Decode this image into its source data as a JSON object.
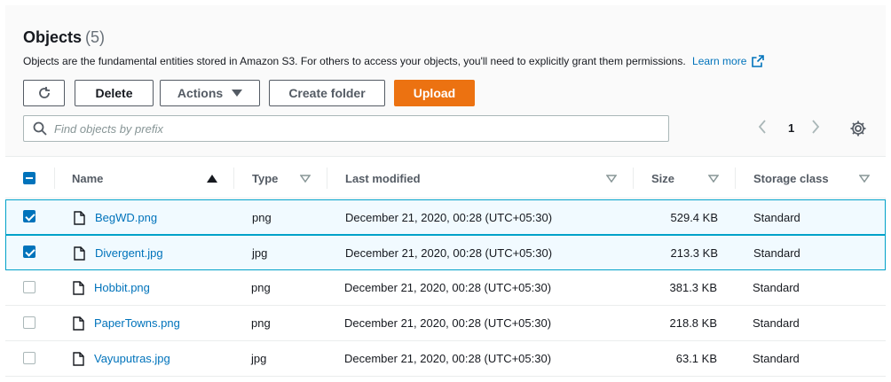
{
  "header": {
    "title": "Objects",
    "count": "(5)",
    "description": "Objects are the fundamental entities stored in Amazon S3. For others to access your objects, you'll need to explicitly grant them permissions.",
    "learn_more": "Learn more"
  },
  "toolbar": {
    "delete_label": "Delete",
    "actions_label": "Actions",
    "create_folder_label": "Create folder",
    "upload_label": "Upload"
  },
  "search": {
    "placeholder": "Find objects by prefix"
  },
  "pagination": {
    "current_page": "1"
  },
  "table": {
    "columns": {
      "name": "Name",
      "type": "Type",
      "last_modified": "Last modified",
      "size": "Size",
      "storage_class": "Storage class"
    },
    "rows": [
      {
        "selected": true,
        "name": "BegWD.png",
        "type": "png",
        "last_modified": "December 21, 2020, 00:28 (UTC+05:30)",
        "size": "529.4 KB",
        "storage_class": "Standard"
      },
      {
        "selected": true,
        "name": "Divergent.jpg",
        "type": "jpg",
        "last_modified": "December 21, 2020, 00:28 (UTC+05:30)",
        "size": "213.3 KB",
        "storage_class": "Standard"
      },
      {
        "selected": false,
        "name": "Hobbit.png",
        "type": "png",
        "last_modified": "December 21, 2020, 00:28 (UTC+05:30)",
        "size": "381.3 KB",
        "storage_class": "Standard"
      },
      {
        "selected": false,
        "name": "PaperTowns.png",
        "type": "png",
        "last_modified": "December 21, 2020, 00:28 (UTC+05:30)",
        "size": "218.8 KB",
        "storage_class": "Standard"
      },
      {
        "selected": false,
        "name": "Vayuputras.jpg",
        "type": "jpg",
        "last_modified": "December 21, 2020, 00:28 (UTC+05:30)",
        "size": "63.1 KB",
        "storage_class": "Standard"
      }
    ]
  },
  "colors": {
    "accent": "#0073bb",
    "upload_button": "#ec7211",
    "selected_row_bg": "#f1faff",
    "selected_row_border": "#00a1c9"
  }
}
